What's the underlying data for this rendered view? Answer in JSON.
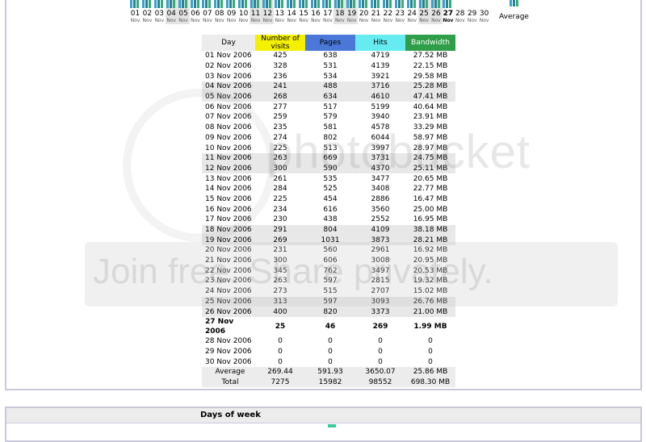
{
  "chart_strip": {
    "days": [
      {
        "day": "01",
        "mon": "Nov"
      },
      {
        "day": "02",
        "mon": "Nov"
      },
      {
        "day": "03",
        "mon": "Nov"
      },
      {
        "day": "04",
        "mon": "Nov",
        "weekend": true
      },
      {
        "day": "05",
        "mon": "Nov",
        "weekend": true
      },
      {
        "day": "06",
        "mon": "Nov"
      },
      {
        "day": "07",
        "mon": "Nov"
      },
      {
        "day": "08",
        "mon": "Nov"
      },
      {
        "day": "09",
        "mon": "Nov"
      },
      {
        "day": "10",
        "mon": "Nov"
      },
      {
        "day": "11",
        "mon": "Nov",
        "weekend": true
      },
      {
        "day": "12",
        "mon": "Nov",
        "weekend": true
      },
      {
        "day": "13",
        "mon": "Nov"
      },
      {
        "day": "14",
        "mon": "Nov"
      },
      {
        "day": "15",
        "mon": "Nov"
      },
      {
        "day": "16",
        "mon": "Nov"
      },
      {
        "day": "17",
        "mon": "Nov"
      },
      {
        "day": "18",
        "mon": "Nov",
        "weekend": true
      },
      {
        "day": "19",
        "mon": "Nov",
        "weekend": true
      },
      {
        "day": "20",
        "mon": "Nov"
      },
      {
        "day": "21",
        "mon": "Nov"
      },
      {
        "day": "22",
        "mon": "Nov"
      },
      {
        "day": "23",
        "mon": "Nov"
      },
      {
        "day": "24",
        "mon": "Nov"
      },
      {
        "day": "25",
        "mon": "Nov",
        "weekend": true
      },
      {
        "day": "26",
        "mon": "Nov",
        "weekend": true
      },
      {
        "day": "27",
        "mon": "Nov",
        "today": true
      },
      {
        "day": "28",
        "mon": "Nov"
      },
      {
        "day": "29",
        "mon": "Nov"
      },
      {
        "day": "30",
        "mon": "Nov"
      }
    ],
    "average_label": "Average",
    "colors": {
      "visits": "#3aa0c8",
      "pages": "#2a7f9a",
      "hits": "#30b070"
    }
  },
  "table": {
    "headers": {
      "day": "Day",
      "visits": "Number of visits",
      "pages": "Pages",
      "hits": "Hits",
      "bandwidth": "Bandwidth"
    },
    "header_colors": {
      "visits": "#f4f000",
      "pages": "#4a78d8",
      "hits": "#66ecf0",
      "bandwidth": "#2e9e48"
    },
    "rows": [
      {
        "day": "01 Nov 2006",
        "visits": "425",
        "pages": "638",
        "hits": "4719",
        "bandwidth": "27.52 MB"
      },
      {
        "day": "02 Nov 2006",
        "visits": "328",
        "pages": "531",
        "hits": "4139",
        "bandwidth": "22.15 MB"
      },
      {
        "day": "03 Nov 2006",
        "visits": "236",
        "pages": "534",
        "hits": "3921",
        "bandwidth": "29.58 MB"
      },
      {
        "day": "04 Nov 2006",
        "visits": "241",
        "pages": "488",
        "hits": "3716",
        "bandwidth": "25.28 MB",
        "weekend": true
      },
      {
        "day": "05 Nov 2006",
        "visits": "268",
        "pages": "634",
        "hits": "4610",
        "bandwidth": "47.41 MB",
        "weekend": true
      },
      {
        "day": "06 Nov 2006",
        "visits": "277",
        "pages": "517",
        "hits": "5199",
        "bandwidth": "40.64 MB"
      },
      {
        "day": "07 Nov 2006",
        "visits": "259",
        "pages": "579",
        "hits": "3940",
        "bandwidth": "23.91 MB"
      },
      {
        "day": "08 Nov 2006",
        "visits": "235",
        "pages": "581",
        "hits": "4578",
        "bandwidth": "33.29 MB"
      },
      {
        "day": "09 Nov 2006",
        "visits": "274",
        "pages": "802",
        "hits": "6044",
        "bandwidth": "58.97 MB"
      },
      {
        "day": "10 Nov 2006",
        "visits": "225",
        "pages": "513",
        "hits": "3997",
        "bandwidth": "28.97 MB"
      },
      {
        "day": "11 Nov 2006",
        "visits": "263",
        "pages": "669",
        "hits": "3731",
        "bandwidth": "24.75 MB",
        "weekend": true
      },
      {
        "day": "12 Nov 2006",
        "visits": "300",
        "pages": "590",
        "hits": "4370",
        "bandwidth": "25.11 MB",
        "weekend": true
      },
      {
        "day": "13 Nov 2006",
        "visits": "261",
        "pages": "535",
        "hits": "3477",
        "bandwidth": "20.65 MB"
      },
      {
        "day": "14 Nov 2006",
        "visits": "284",
        "pages": "525",
        "hits": "3408",
        "bandwidth": "22.77 MB"
      },
      {
        "day": "15 Nov 2006",
        "visits": "225",
        "pages": "454",
        "hits": "2886",
        "bandwidth": "16.47 MB"
      },
      {
        "day": "16 Nov 2006",
        "visits": "234",
        "pages": "616",
        "hits": "3560",
        "bandwidth": "25.00 MB"
      },
      {
        "day": "17 Nov 2006",
        "visits": "230",
        "pages": "438",
        "hits": "2552",
        "bandwidth": "16.95 MB"
      },
      {
        "day": "18 Nov 2006",
        "visits": "291",
        "pages": "804",
        "hits": "4109",
        "bandwidth": "38.18 MB",
        "weekend": true
      },
      {
        "day": "19 Nov 2006",
        "visits": "269",
        "pages": "1031",
        "hits": "3873",
        "bandwidth": "28.21 MB",
        "weekend": true
      },
      {
        "day": "20 Nov 2006",
        "visits": "231",
        "pages": "560",
        "hits": "2961",
        "bandwidth": "16.92 MB"
      },
      {
        "day": "21 Nov 2006",
        "visits": "300",
        "pages": "606",
        "hits": "3008",
        "bandwidth": "20.95 MB"
      },
      {
        "day": "22 Nov 2006",
        "visits": "345",
        "pages": "762",
        "hits": "3497",
        "bandwidth": "20.53 MB"
      },
      {
        "day": "23 Nov 2006",
        "visits": "263",
        "pages": "597",
        "hits": "2815",
        "bandwidth": "19.32 MB"
      },
      {
        "day": "24 Nov 2006",
        "visits": "273",
        "pages": "515",
        "hits": "2707",
        "bandwidth": "15.02 MB"
      },
      {
        "day": "25 Nov 2006",
        "visits": "313",
        "pages": "597",
        "hits": "3093",
        "bandwidth": "26.76 MB",
        "weekend": true
      },
      {
        "day": "26 Nov 2006",
        "visits": "400",
        "pages": "820",
        "hits": "3373",
        "bandwidth": "21.00 MB",
        "weekend": true
      },
      {
        "day": "27 Nov 2006",
        "visits": "25",
        "pages": "46",
        "hits": "269",
        "bandwidth": "1.99 MB",
        "today": true
      },
      {
        "day": "28 Nov 2006",
        "visits": "0",
        "pages": "0",
        "hits": "0",
        "bandwidth": "0"
      },
      {
        "day": "29 Nov 2006",
        "visits": "0",
        "pages": "0",
        "hits": "0",
        "bandwidth": "0"
      },
      {
        "day": "30 Nov 2006",
        "visits": "0",
        "pages": "0",
        "hits": "0",
        "bandwidth": "0"
      }
    ],
    "average": {
      "label": "Average",
      "visits": "269.44",
      "pages": "591.93",
      "hits": "3650.07",
      "bandwidth": "25.86 MB"
    },
    "total": {
      "label": "Total",
      "visits": "7275",
      "pages": "15982",
      "hits": "98552",
      "bandwidth": "698.30 MB"
    }
  },
  "next_section": {
    "title": "Days of week"
  },
  "watermark": {
    "line1": "photobucket",
    "line2": "Join free. Share privately."
  }
}
